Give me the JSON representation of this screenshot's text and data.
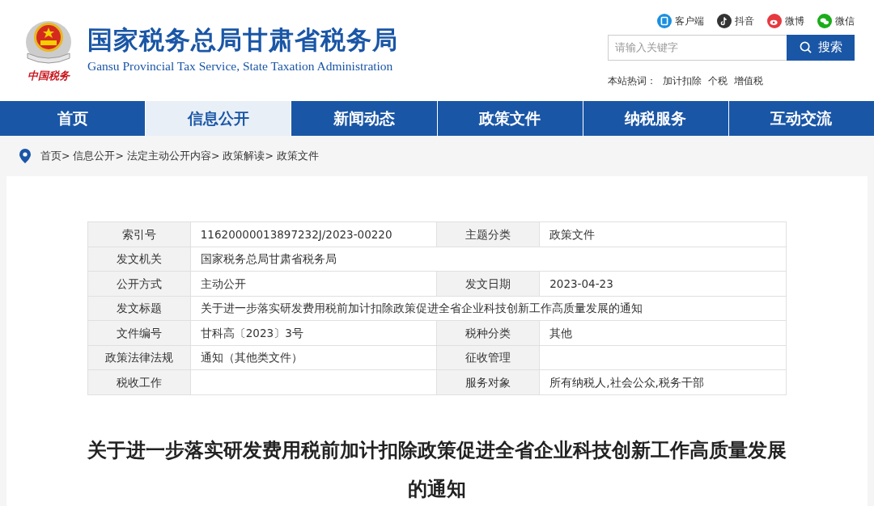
{
  "header": {
    "logo_caption": "中国税务",
    "title": "国家税务总局甘肃省税务局",
    "subtitle": "Gansu Provincial Tax Service, State Taxation Administration"
  },
  "social_links": [
    {
      "kind": "client",
      "label": "客户端"
    },
    {
      "kind": "douyin",
      "label": "抖音"
    },
    {
      "kind": "weibo",
      "label": "微博"
    },
    {
      "kind": "wechat",
      "label": "微信"
    }
  ],
  "search": {
    "placeholder": "请输入关键字",
    "button": "搜索"
  },
  "hot_words": {
    "label": "本站热词：",
    "items": [
      "加计扣除",
      "个税",
      "增值税"
    ]
  },
  "nav": [
    {
      "label": "首页",
      "selected": false
    },
    {
      "label": "信息公开",
      "selected": true
    },
    {
      "label": "新闻动态",
      "selected": false
    },
    {
      "label": "政策文件",
      "selected": false
    },
    {
      "label": "纳税服务",
      "selected": false
    },
    {
      "label": "互动交流",
      "selected": false
    }
  ],
  "breadcrumb": [
    "首页>",
    "信息公开>",
    "法定主动公开内容>",
    "政策解读>",
    "政策文件"
  ],
  "info_table": {
    "rows": [
      {
        "cells": [
          {
            "label": "索引号",
            "value": "11620000013897232J/2023-00220"
          },
          {
            "label": "主题分类",
            "value": "政策文件"
          }
        ]
      },
      {
        "cells": [
          {
            "label": "发文机关",
            "value": "国家税务总局甘肃省税务局"
          }
        ]
      },
      {
        "cells": [
          {
            "label": "公开方式",
            "value": "主动公开"
          },
          {
            "label": "发文日期",
            "value": "2023-04-23"
          }
        ]
      },
      {
        "cells": [
          {
            "label": "发文标题",
            "value": "关于进一步落实研发费用税前加计扣除政策促进全省企业科技创新工作高质量发展的通知"
          }
        ]
      },
      {
        "cells": [
          {
            "label": "文件编号",
            "value": "甘科高〔2023〕3号"
          },
          {
            "label": "税种分类",
            "value": "其他"
          }
        ]
      },
      {
        "cells": [
          {
            "label": "政策法律法规",
            "value": "通知（其他类文件）"
          },
          {
            "label": "征收管理"
          }
        ]
      },
      {
        "cells": [
          {
            "label": "税收工作"
          },
          {
            "label": "服务对象",
            "value": "所有纳税人,社会公众,税务干部"
          }
        ]
      }
    ]
  },
  "article_title": "关于进一步落实研发费用税前加计扣除政策促进全省企业科技创新工作高质量发展的通知"
}
